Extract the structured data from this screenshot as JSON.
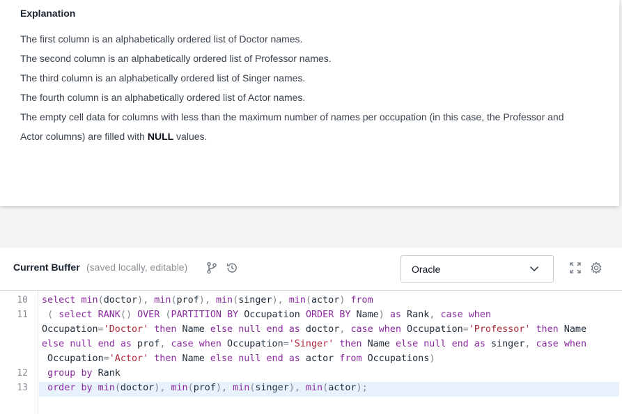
{
  "explanation": {
    "heading": "Explanation",
    "lines": [
      "The first column is an alphabetically ordered list of Doctor names.",
      "The second column is an alphabetically ordered list of Professor names.",
      "The third column is an alphabetically ordered list of Singer names.",
      "The fourth column is an alphabetically ordered list of Actor names.",
      "The empty cell data for columns with less than the maximum number of names per occupation (in this case, the Professor and",
      "Actor columns) are filled with"
    ],
    "null_word": "NULL",
    "null_tail": " values."
  },
  "editor": {
    "title": "Current Buffer",
    "subtitle": "(saved locally, editable)",
    "language": "Oracle",
    "icons": [
      "branch-icon",
      "history-icon",
      "expand-icon",
      "settings-icon"
    ],
    "line_numbers": [
      "10",
      "11",
      "12",
      "13"
    ],
    "code_lines": [
      "select min(doctor), min(prof), min(singer), min(actor) from",
      " ( select RANK() OVER (PARTITION BY Occupation ORDER BY Name) as Rank, case when",
      "Occupation='Doctor' then Name else null end as doctor, case when Occupation='Professor' then Name",
      "else null end as prof, case when Occupation='Singer' then Name else null end as singer, case when",
      " Occupation='Actor' then Name else null end as actor from Occupations)",
      " group by Rank",
      " order by min(doctor), min(prof), min(singer), min(actor);"
    ]
  },
  "colors": {
    "keyword": "#8a2a9e",
    "string": "#b0283c",
    "active_line": "#e8f2fc"
  }
}
